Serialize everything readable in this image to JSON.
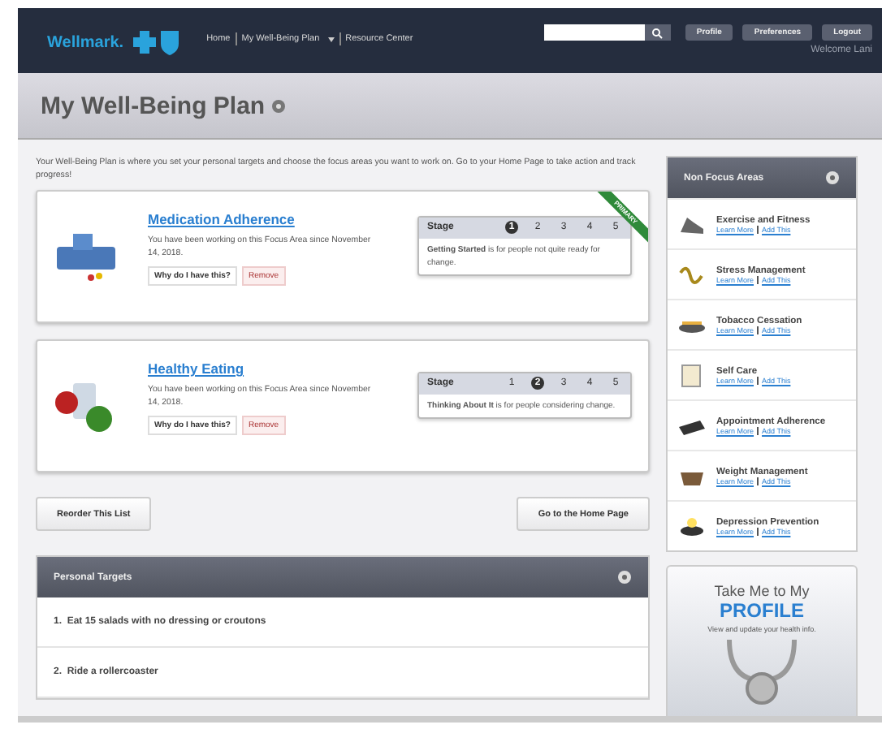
{
  "header": {
    "logo": "Wellmark.",
    "nav": [
      {
        "label": "Home",
        "dropdown": false
      },
      {
        "label": "My Well-Being Plan",
        "dropdown": true
      },
      {
        "label": "Resource Center",
        "dropdown": false
      }
    ],
    "buttons": [
      "Profile",
      "Preferences",
      "Logout"
    ],
    "welcome": "Welcome Lani"
  },
  "page_title": "My Well-Being Plan",
  "intro": "Your Well-Being Plan is where you set your personal targets and choose the focus areas you want to work on. Go to your Home Page to take action and track progress!",
  "focus_areas": [
    {
      "title": "Medication Adherence",
      "ribbon": "PRIMARY",
      "description": "You have been working on this Focus Area since November 14, 2018.",
      "why": "Why do I have this?",
      "remove": "Remove",
      "stage_label": "Stage",
      "stages": [
        {
          "label": "1",
          "selected": true
        },
        {
          "label": "2",
          "selected": false
        },
        {
          "label": "3",
          "selected": false
        },
        {
          "label": "4",
          "selected": false
        },
        {
          "label": "5",
          "selected": false
        }
      ],
      "stage_text": "**Getting Started** is for people not quite ready for change."
    },
    {
      "title": "Healthy Eating",
      "description": "You have been working on this Focus Area since November 14, 2018.",
      "why": "Why do I have this?",
      "remove": "Remove",
      "stage_label": "Stage",
      "stages": [
        {
          "label": "1",
          "selected": false
        },
        {
          "label": "2",
          "selected": true
        },
        {
          "label": "3",
          "selected": false
        },
        {
          "label": "4",
          "selected": false
        },
        {
          "label": "5",
          "selected": false
        }
      ],
      "stage_text": "**Thinking About It** is for people considering change."
    }
  ],
  "actions": [
    "Reorder This List",
    "Go to the Home Page"
  ],
  "personal_targets": {
    "title": "Personal Targets",
    "items": [
      "1.  Eat 15 salads with no dressing or croutons",
      "2.  Ride a rollercoaster"
    ]
  },
  "non_focus_areas": {
    "title": "Non Focus Areas",
    "items": [
      {
        "name": "Exercise and Fitness",
        "learn": "Learn More",
        "add": "Add This"
      },
      {
        "name": "Stress Management",
        "learn": "Learn More",
        "add": "Add This"
      },
      {
        "name": "Tobacco Cessation",
        "learn": "Learn More",
        "add": "Add This"
      },
      {
        "name": "Self Care",
        "learn": "Learn More",
        "add": "Add This"
      },
      {
        "name": "Appointment Adherence",
        "learn": "Learn More",
        "add": "Add This"
      },
      {
        "name": "Weight Management",
        "learn": "Learn More",
        "add": "Add This"
      },
      {
        "name": "Depression Prevention",
        "learn": "Learn More",
        "add": "Add This"
      }
    ]
  },
  "profile_promo": {
    "line1": "Take Me to My",
    "line2": "PROFILE",
    "line3": "View and update your health info."
  }
}
